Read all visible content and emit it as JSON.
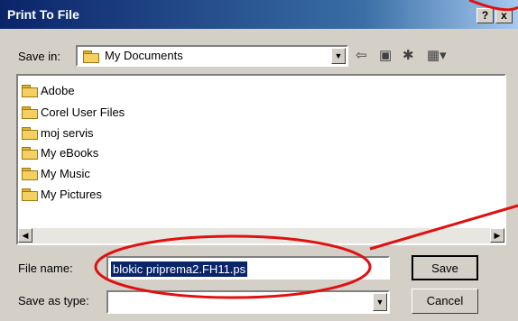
{
  "window": {
    "title": "Print To File",
    "help_label": "?",
    "close_label": "x"
  },
  "save_in": {
    "label": "Save in:",
    "value": "My Documents"
  },
  "file_list": {
    "items": [
      {
        "name": "Adobe",
        "icon": "folder-icon"
      },
      {
        "name": "Corel User Files",
        "icon": "folder-icon"
      },
      {
        "name": "moj servis",
        "icon": "folder-icon"
      },
      {
        "name": "My eBooks",
        "icon": "folder-icon"
      },
      {
        "name": "My Music",
        "icon": "music-folder-icon"
      },
      {
        "name": "My Pictures",
        "icon": "pictures-folder-icon"
      }
    ]
  },
  "file_name": {
    "label": "File name:",
    "value": "blokic priprema2.FH11.ps"
  },
  "save_as_type": {
    "label": "Save as type:",
    "value": ""
  },
  "buttons": {
    "save": "Save",
    "cancel": "Cancel"
  },
  "colors": {
    "title_bar": "#0a246a",
    "annotation": "#e01010"
  }
}
